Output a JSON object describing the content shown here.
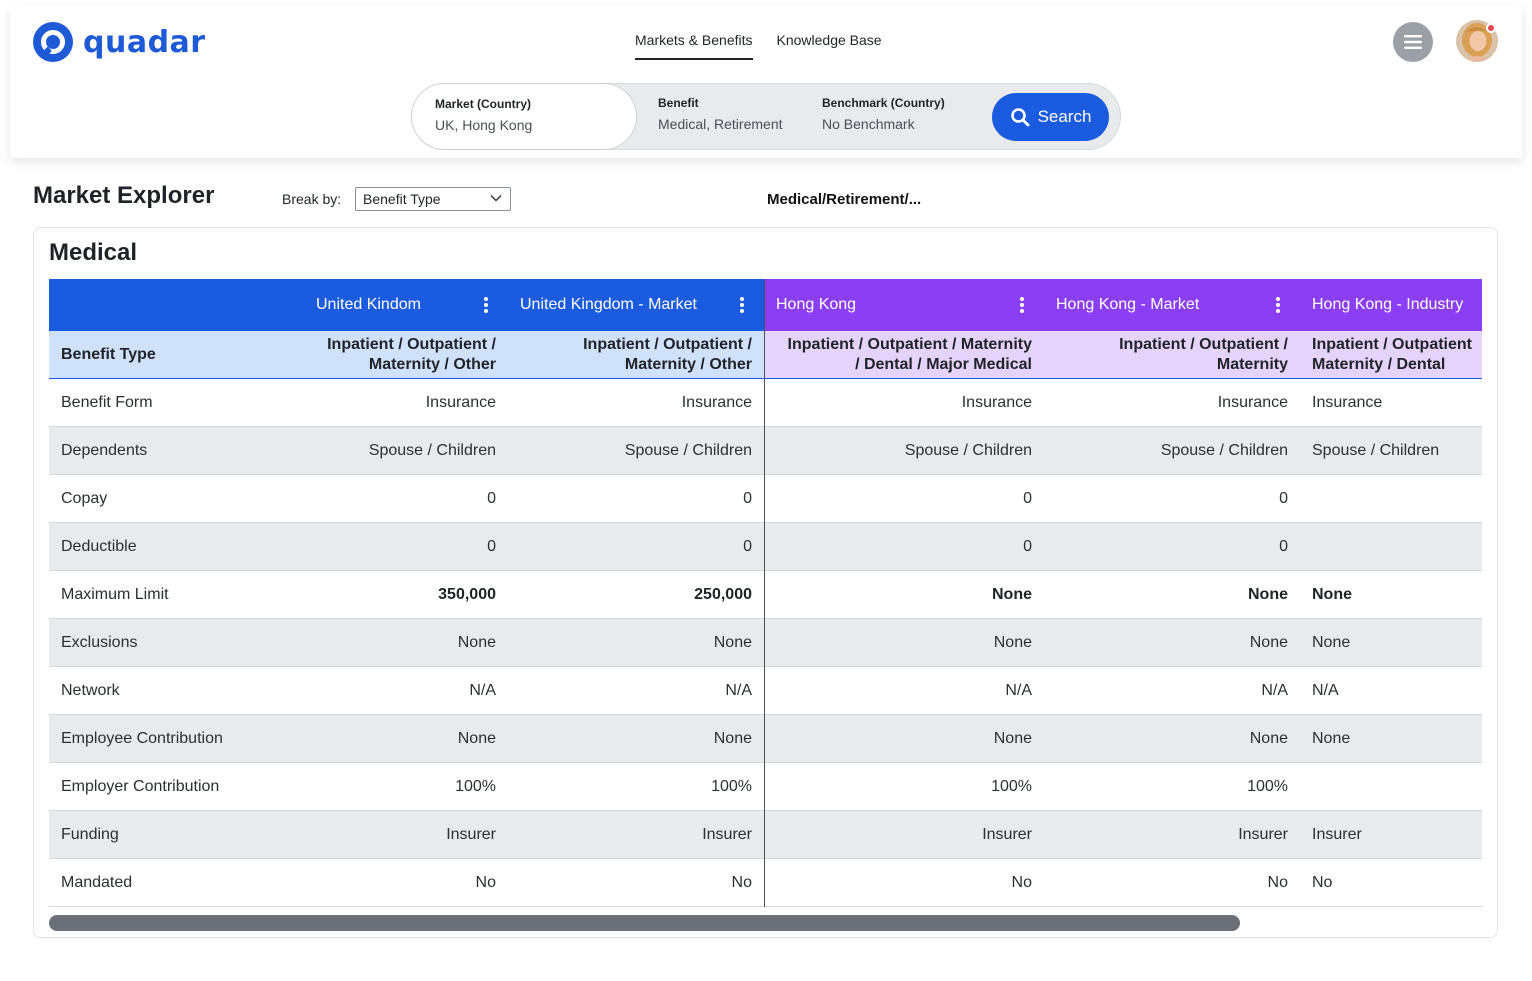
{
  "app": {
    "name": "quadar"
  },
  "nav": {
    "items": [
      {
        "label": "Markets & Benefits",
        "active": true
      },
      {
        "label": "Knowledge Base",
        "active": false
      }
    ]
  },
  "search": {
    "market": {
      "label": "Market (Country)",
      "value": "UK, Hong Kong"
    },
    "benefit": {
      "label": "Benefit",
      "value": "Medical, Retirement"
    },
    "benchmark": {
      "label": "Benchmark (Country)",
      "value": "No Benchmark"
    },
    "button_label": "Search"
  },
  "explorer": {
    "title": "Market Explorer",
    "break_by_label": "Break by:",
    "break_by_value": "Benefit Type",
    "breadcrumb": "Medical/Retirement/..."
  },
  "section": {
    "title": "Medical",
    "columns": [
      {
        "name": "United Kindom",
        "group": "UK"
      },
      {
        "name": "United Kingdom - Market",
        "group": "UK"
      },
      {
        "name": "Hong Kong",
        "group": "HK"
      },
      {
        "name": "Hong Kong - Market",
        "group": "HK"
      },
      {
        "name": "Hong Kong - Industry",
        "group": "HK"
      }
    ],
    "benefit_type": {
      "label": "Benefit Type",
      "values": [
        "Inpatient / Outpatient /\nMaternity / Other",
        "Inpatient / Outpatient /\nMaternity / Other",
        "Inpatient / Outpatient / Maternity\n/ Dental / Major Medical",
        "Inpatient / Outpatient /\nMaternity",
        "Inpatient / Outpatient\nMaternity / Dental"
      ]
    },
    "rows": [
      {
        "label": "Benefit Form",
        "values": [
          "Insurance",
          "Insurance",
          "Insurance",
          "Insurance",
          "Insurance"
        ]
      },
      {
        "label": "Dependents",
        "values": [
          "Spouse / Children",
          "Spouse / Children",
          "Spouse / Children",
          "Spouse / Children",
          "Spouse / Children"
        ]
      },
      {
        "label": "Copay",
        "values": [
          "0",
          "0",
          "0",
          "0",
          ""
        ]
      },
      {
        "label": "Deductible",
        "values": [
          "0",
          "0",
          "0",
          "0",
          ""
        ]
      },
      {
        "label": "Maximum Limit",
        "values": [
          "350,000",
          "250,000",
          "None",
          "None",
          "None"
        ]
      },
      {
        "label": "Exclusions",
        "values": [
          "None",
          "None",
          "None",
          "None",
          "None"
        ]
      },
      {
        "label": "Network",
        "values": [
          "N/A",
          "N/A",
          "N/A",
          "N/A",
          "N/A"
        ]
      },
      {
        "label": "Employee Contribution",
        "values": [
          "None",
          "None",
          "None",
          "None",
          "None"
        ]
      },
      {
        "label": "Employer Contribution",
        "values": [
          "100%",
          "100%",
          "100%",
          "100%",
          ""
        ]
      },
      {
        "label": "Funding",
        "values": [
          "Insurer",
          "Insurer",
          "Insurer",
          "Insurer",
          "Insurer"
        ]
      },
      {
        "label": "Mandated",
        "values": [
          "No",
          "No",
          "No",
          "No",
          "No"
        ]
      }
    ]
  },
  "colors": {
    "brand": "#1e5ad6",
    "uk_header": "#1a5be0",
    "hk_header": "#8b3ff5",
    "uk_subheader": "#cfe1fb",
    "hk_subheader": "#e4d4fb",
    "notification": "#e5484d"
  },
  "icons": [
    "logo-icon",
    "hamburger-menu-icon",
    "search-icon",
    "chevron-down-icon",
    "kebab-menu-icon"
  ]
}
